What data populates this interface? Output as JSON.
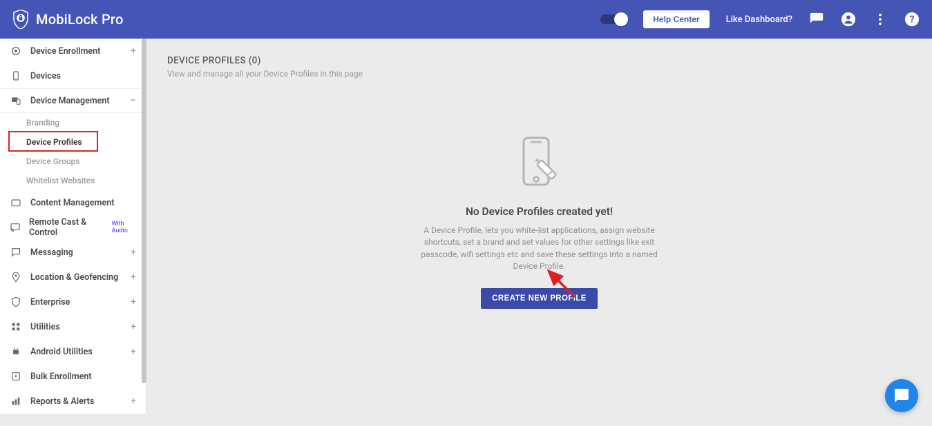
{
  "header": {
    "app_name": "MobiLock Pro",
    "help_center_label": "Help Center",
    "like_dashboard_label": "Like Dashboard?"
  },
  "sidebar": {
    "items": [
      {
        "label": "Device Enrollment",
        "expandable": "+"
      },
      {
        "label": "Devices"
      },
      {
        "label": "Device Management",
        "expandable": "–"
      },
      {
        "label": "Content Management"
      },
      {
        "label": "Remote Cast & Control",
        "badge": "With Audio"
      },
      {
        "label": "Messaging",
        "expandable": "+"
      },
      {
        "label": "Location & Geofencing",
        "expandable": "+"
      },
      {
        "label": "Enterprise",
        "expandable": "+"
      },
      {
        "label": "Utilities",
        "expandable": "+"
      },
      {
        "label": "Android Utilities",
        "expandable": "+"
      },
      {
        "label": "Bulk Enrollment"
      },
      {
        "label": "Reports & Alerts",
        "expandable": "+"
      }
    ],
    "device_mgmt_sub": [
      {
        "label": "Branding"
      },
      {
        "label": "Device Profiles",
        "active": true
      },
      {
        "label": "Device Groups"
      },
      {
        "label": "Whitelist Websites"
      }
    ]
  },
  "main": {
    "title": "DEVICE PROFILES (0)",
    "subtitle": "View and manage all your Device Profiles in this page",
    "empty_heading": "No Device Profiles created yet!",
    "empty_desc": "A Device Profile, lets you white-list applications, assign website shortcuts, set a brand and set values for other settings like exit passcode, wifi settings etc and save these settings into a named Device Profile.",
    "create_btn": "CREATE NEW PROFILE"
  }
}
